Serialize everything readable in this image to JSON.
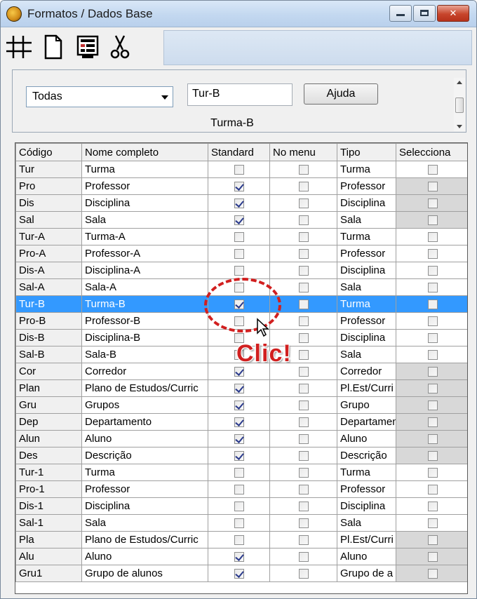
{
  "window": {
    "title": "Formatos / Dados Base"
  },
  "toolbar": {
    "icons": [
      "grid-icon",
      "new-document-icon",
      "form-view-icon",
      "cut-icon"
    ]
  },
  "filter": {
    "selected": "Todas",
    "code_value": "Tur-B",
    "help_label": "Ajuda",
    "full_name": "Turma-B"
  },
  "grid": {
    "headers": [
      "Código",
      "Nome completo",
      "Standard",
      "No menu",
      "Tipo",
      "Selecciona"
    ],
    "rows": [
      {
        "code": "Tur",
        "name": "Turma",
        "standard": false,
        "menu": false,
        "type": "Turma",
        "select": false,
        "grey": false
      },
      {
        "code": "Pro",
        "name": "Professor",
        "standard": true,
        "menu": false,
        "type": "Professor",
        "select": false,
        "grey": true
      },
      {
        "code": "Dis",
        "name": "Disciplina",
        "standard": true,
        "menu": false,
        "type": "Disciplina",
        "select": false,
        "grey": true
      },
      {
        "code": "Sal",
        "name": "Sala",
        "standard": true,
        "menu": false,
        "type": "Sala",
        "select": false,
        "grey": true
      },
      {
        "code": "Tur-A",
        "name": "Turma-A",
        "standard": false,
        "menu": false,
        "type": "Turma",
        "select": false,
        "grey": false
      },
      {
        "code": "Pro-A",
        "name": "Professor-A",
        "standard": false,
        "menu": false,
        "type": "Professor",
        "select": false,
        "grey": false
      },
      {
        "code": "Dis-A",
        "name": "Disciplina-A",
        "standard": false,
        "menu": false,
        "type": "Disciplina",
        "select": false,
        "grey": false
      },
      {
        "code": "Sal-A",
        "name": "Sala-A",
        "standard": false,
        "menu": false,
        "type": "Sala",
        "select": false,
        "grey": false
      },
      {
        "code": "Tur-B",
        "name": "Turma-B",
        "standard": true,
        "menu": false,
        "type": "Turma",
        "select": false,
        "grey": false,
        "selected": true
      },
      {
        "code": "Pro-B",
        "name": "Professor-B",
        "standard": false,
        "menu": false,
        "type": "Professor",
        "select": false,
        "grey": false
      },
      {
        "code": "Dis-B",
        "name": "Disciplina-B",
        "standard": false,
        "menu": false,
        "type": "Disciplina",
        "select": false,
        "grey": false
      },
      {
        "code": "Sal-B",
        "name": "Sala-B",
        "standard": false,
        "menu": false,
        "type": "Sala",
        "select": false,
        "grey": false
      },
      {
        "code": "Cor",
        "name": "Corredor",
        "standard": true,
        "menu": false,
        "type": "Corredor",
        "select": false,
        "grey": true
      },
      {
        "code": "Plan",
        "name": "Plano de Estudos/Curric",
        "standard": true,
        "menu": false,
        "type": "Pl.Est/Curri",
        "select": false,
        "grey": true
      },
      {
        "code": "Gru",
        "name": "Grupos",
        "standard": true,
        "menu": false,
        "type": "Grupo",
        "select": false,
        "grey": true
      },
      {
        "code": "Dep",
        "name": "Departamento",
        "standard": true,
        "menu": false,
        "type": "Departamen",
        "select": false,
        "grey": true
      },
      {
        "code": "Alun",
        "name": "Aluno",
        "standard": true,
        "menu": false,
        "type": "Aluno",
        "select": false,
        "grey": true
      },
      {
        "code": "Des",
        "name": "Descrição",
        "standard": true,
        "menu": false,
        "type": "Descrição",
        "select": false,
        "grey": true
      },
      {
        "code": "Tur-1",
        "name": "Turma",
        "standard": false,
        "menu": false,
        "type": "Turma",
        "select": false,
        "grey": false
      },
      {
        "code": "Pro-1",
        "name": "Professor",
        "standard": false,
        "menu": false,
        "type": "Professor",
        "select": false,
        "grey": false
      },
      {
        "code": "Dis-1",
        "name": "Disciplina",
        "standard": false,
        "menu": false,
        "type": "Disciplina",
        "select": false,
        "grey": false
      },
      {
        "code": "Sal-1",
        "name": "Sala",
        "standard": false,
        "menu": false,
        "type": "Sala",
        "select": false,
        "grey": false
      },
      {
        "code": "Pla",
        "name": "Plano de Estudos/Curric",
        "standard": false,
        "menu": false,
        "type": "Pl.Est/Curri",
        "select": false,
        "grey": true
      },
      {
        "code": "Alu",
        "name": "Aluno",
        "standard": true,
        "menu": false,
        "type": "Aluno",
        "select": false,
        "grey": true
      },
      {
        "code": "Gru1",
        "name": "Grupo de alunos",
        "standard": true,
        "menu": false,
        "type": "Grupo de a",
        "select": false,
        "grey": true
      }
    ]
  },
  "annotation": {
    "text": "Clic!",
    "color": "#d11f1f"
  },
  "colors": {
    "selection": "#3399ff",
    "accent_red": "#d11f1f"
  }
}
